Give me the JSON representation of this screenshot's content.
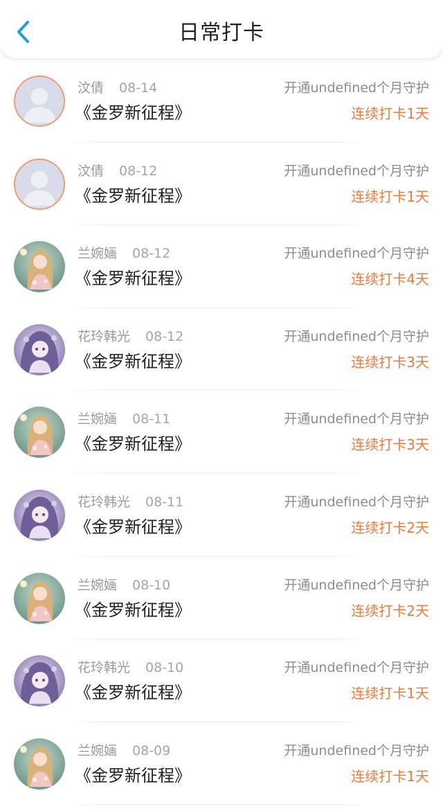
{
  "header": {
    "title": "日常打卡",
    "back_icon": "chevron-left-icon",
    "accent_color": "#1a9fe0"
  },
  "colors": {
    "streak": "#f0793b",
    "avatar_border": "#f29a72"
  },
  "records": [
    {
      "user": "汶倩",
      "date": "08-14",
      "book": "《金罗新征程》",
      "guard": "开通undefined个月守护",
      "streak": "连续打卡1天",
      "avatar": "default-avatar"
    },
    {
      "user": "汶倩",
      "date": "08-12",
      "book": "《金罗新征程》",
      "guard": "开通undefined个月守护",
      "streak": "连续打卡1天",
      "avatar": "default-avatar"
    },
    {
      "user": "兰婉婳",
      "date": "08-12",
      "book": "《金罗新征程》",
      "guard": "开通undefined个月守护",
      "streak": "连续打卡4天",
      "avatar": "anime-girl-blonde-avatar"
    },
    {
      "user": "花玲韩光",
      "date": "08-12",
      "book": "《金罗新征程》",
      "guard": "开通undefined个月守护",
      "streak": "连续打卡3天",
      "avatar": "anime-girl-purple-avatar"
    },
    {
      "user": "兰婉婳",
      "date": "08-11",
      "book": "《金罗新征程》",
      "guard": "开通undefined个月守护",
      "streak": "连续打卡3天",
      "avatar": "anime-girl-blonde-avatar"
    },
    {
      "user": "花玲韩光",
      "date": "08-11",
      "book": "《金罗新征程》",
      "guard": "开通undefined个月守护",
      "streak": "连续打卡2天",
      "avatar": "anime-girl-purple-avatar"
    },
    {
      "user": "兰婉婳",
      "date": "08-10",
      "book": "《金罗新征程》",
      "guard": "开通undefined个月守护",
      "streak": "连续打卡2天",
      "avatar": "anime-girl-blonde-avatar"
    },
    {
      "user": "花玲韩光",
      "date": "08-10",
      "book": "《金罗新征程》",
      "guard": "开通undefined个月守护",
      "streak": "连续打卡1天",
      "avatar": "anime-girl-purple-avatar"
    },
    {
      "user": "兰婉婳",
      "date": "08-09",
      "book": "《金罗新征程》",
      "guard": "开通undefined个月守护",
      "streak": "连续打卡1天",
      "avatar": "anime-girl-blonde-avatar"
    }
  ]
}
